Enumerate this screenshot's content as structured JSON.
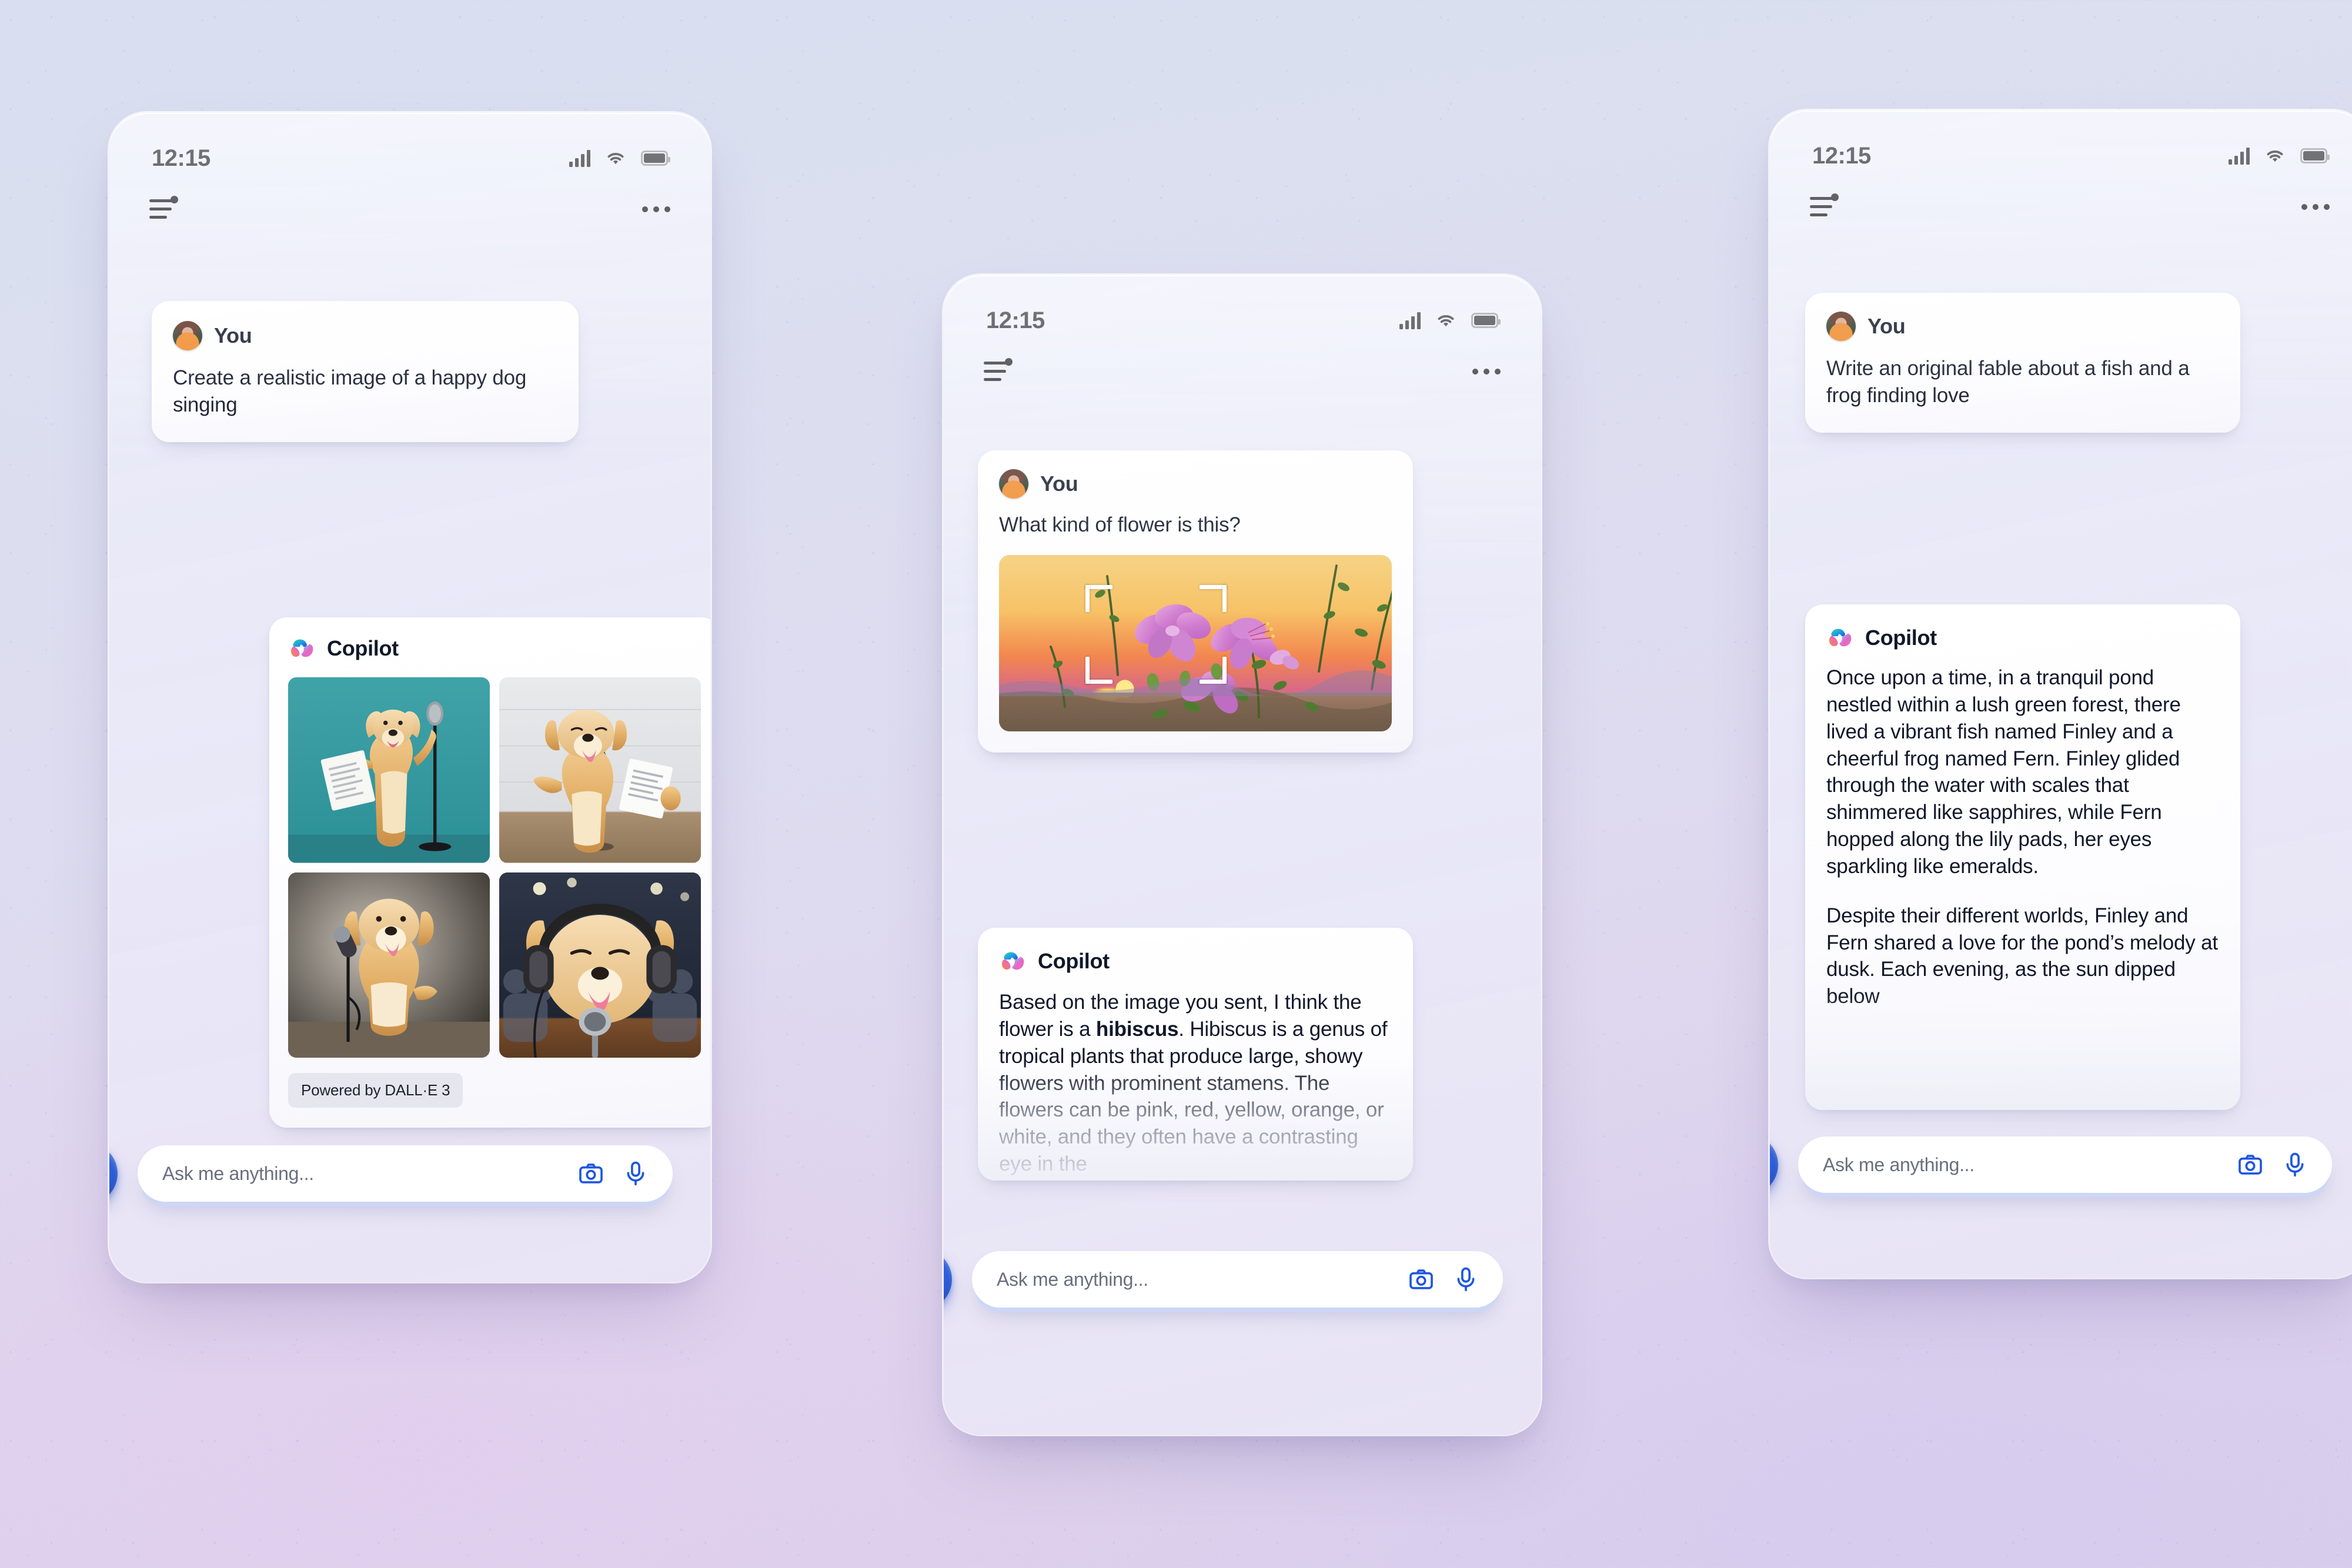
{
  "background": {
    "top_color": "#d8dff0",
    "bottom_color": "#d9cdeb"
  },
  "theme": {
    "accent_blue": "#2554cf",
    "card_white": "#ffffff",
    "text_primary": "#11182a",
    "text_muted": "#6a6f7d",
    "badge_bg": "#e6e6ef"
  },
  "phones": [
    {
      "id": "phone-left",
      "status": {
        "time": "12:15",
        "signal_icon": "cellular-bars-icon",
        "wifi_icon": "wifi-icon",
        "battery_icon": "battery-full-icon"
      },
      "appbar": {
        "menu_icon": "sliders-menu-icon",
        "more_icon": "more-options-icon"
      },
      "messages": [
        {
          "role": "user",
          "sender": "You",
          "avatar_icon": "user-avatar",
          "text": "Create a realistic image of a happy dog singing"
        },
        {
          "role": "assistant",
          "sender": "Copilot",
          "avatar_icon": "copilot-logo-icon",
          "images": [
            {
              "alt": "golden retriever standing with sheet music and microphone on teal background"
            },
            {
              "alt": "golden retriever singing into microphone holding sheet music"
            },
            {
              "alt": "golden retriever singing into microphone on grey backdrop"
            },
            {
              "alt": "golden retriever with headphones singing into vintage microphone on stage"
            }
          ],
          "badge": "Powered by DALL·E 3"
        }
      ],
      "composer": {
        "fab_icon": "new-chat-bubble-plus-icon",
        "placeholder": "Ask me anything...",
        "camera_icon": "camera-icon",
        "mic_icon": "microphone-icon"
      }
    },
    {
      "id": "phone-middle",
      "status": {
        "time": "12:15",
        "signal_icon": "cellular-bars-icon",
        "wifi_icon": "wifi-icon",
        "battery_icon": "battery-full-icon"
      },
      "appbar": {
        "menu_icon": "sliders-menu-icon",
        "more_icon": "more-options-icon"
      },
      "messages": [
        {
          "role": "user",
          "sender": "You",
          "avatar_icon": "user-avatar",
          "text": "What kind of flower is this?",
          "photo": {
            "alt": "purple hibiscus flowers at sunset with scan reticle overlay",
            "reticle_icon": "scan-reticle-icon"
          }
        },
        {
          "role": "assistant",
          "sender": "Copilot",
          "avatar_icon": "copilot-logo-icon",
          "text_parts": [
            {
              "t": "Based on the image you sent, I think the flower is a ",
              "bold": false
            },
            {
              "t": "hibiscus",
              "bold": true
            },
            {
              "t": ". Hibiscus is a genus of tropical plants that produce large, showy flowers with prominent stamens. The flowers can be pink, red, yellow, orange, or white, and they often have a contrasting eye in the",
              "bold": false
            }
          ],
          "truncated": true
        }
      ],
      "composer": {
        "fab_icon": "new-chat-bubble-plus-icon",
        "placeholder": "Ask me anything...",
        "camera_icon": "camera-icon",
        "mic_icon": "microphone-icon"
      }
    },
    {
      "id": "phone-right",
      "status": {
        "time": "12:15",
        "signal_icon": "cellular-bars-icon",
        "wifi_icon": "wifi-icon",
        "battery_icon": "battery-full-icon"
      },
      "appbar": {
        "menu_icon": "sliders-menu-icon",
        "more_icon": "more-options-icon"
      },
      "messages": [
        {
          "role": "user",
          "sender": "You",
          "avatar_icon": "user-avatar",
          "text": "Write an original fable about a fish and a frog finding love"
        },
        {
          "role": "assistant",
          "sender": "Copilot",
          "avatar_icon": "copilot-logo-icon",
          "paragraph_1": "Once upon a time, in a tranquil pond nestled within a lush green forest, there lived a vibrant fish named Finley and a cheerful frog named Fern. Finley glided through the water with scales that shimmered like sapphires, while Fern hopped along the lily pads, her eyes sparkling like emeralds.",
          "paragraph_2": "Despite their different worlds, Finley and Fern shared a love for the pond’s melody at dusk. Each evening, as the sun dipped below",
          "truncated": true
        }
      ],
      "composer": {
        "fab_icon": "new-chat-bubble-plus-icon",
        "placeholder": "Ask me anything...",
        "camera_icon": "camera-icon",
        "mic_icon": "microphone-icon"
      }
    }
  ]
}
